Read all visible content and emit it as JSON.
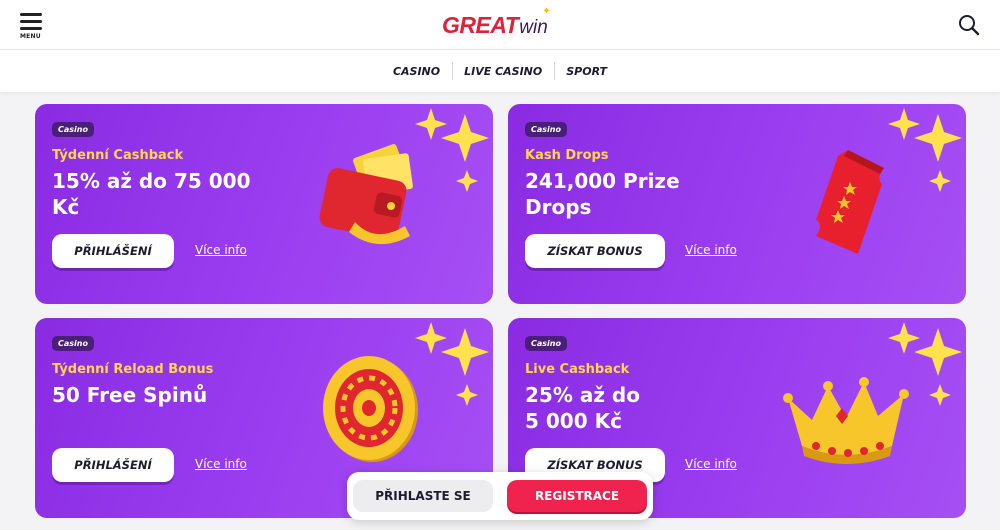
{
  "header": {
    "menu_label": "MENU",
    "logo_great": "GREAT",
    "logo_win": "win"
  },
  "nav": {
    "items": [
      {
        "label": "CASINO"
      },
      {
        "label": "LIVE CASINO"
      },
      {
        "label": "SPORT"
      }
    ]
  },
  "promos": [
    {
      "badge": "Casino",
      "subtitle": "Týdenní Cashback",
      "title_line1": "15% až do 75 000",
      "title_line2": "Kč",
      "cta": "PŘIHLÁŠENÍ",
      "more": "Více info",
      "art": "wallet-icon"
    },
    {
      "badge": "Casino",
      "subtitle": "Kash Drops",
      "title_line1": "241,000 Prize",
      "title_line2": "Drops",
      "cta": "ZÍSKAT BONUS",
      "more": "Více info",
      "art": "ticket-icon"
    },
    {
      "badge": "Casino",
      "subtitle": "Týdenní Reload Bonus",
      "title_line1": "50 Free Spinů",
      "title_line2": "",
      "cta": "PŘIHLÁŠENÍ",
      "more": "Více info",
      "art": "roulette-coin-icon"
    },
    {
      "badge": "Casino",
      "subtitle": "Live Cashback",
      "title_line1": "25% až do",
      "title_line2": "5 000 Kč",
      "cta": "ZÍSKAT BONUS",
      "more": "Více info",
      "art": "crown-icon"
    }
  ],
  "auth": {
    "login": "PŘIHLASTE SE",
    "register": "REGISTRACE"
  },
  "colors": {
    "brand_red": "#e0213a",
    "card_purple": "#9b3ef0",
    "accent_yellow": "#ffd54a",
    "register_red": "#f0234e"
  }
}
